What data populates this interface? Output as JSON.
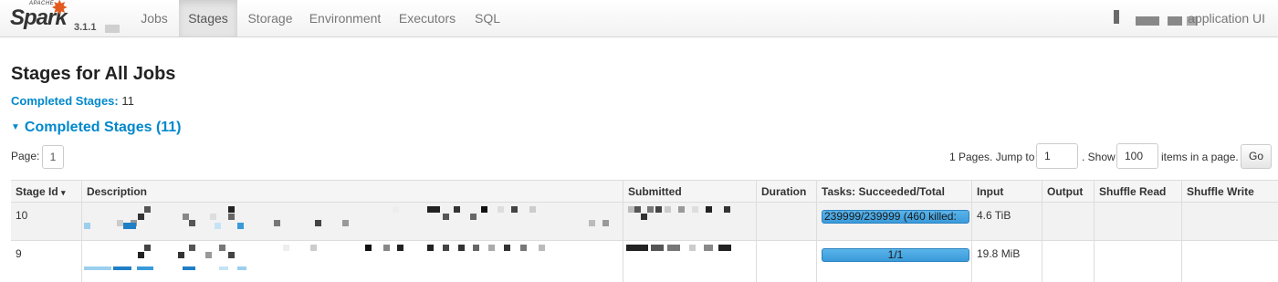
{
  "brand": {
    "apache": "APACHE",
    "name": "Spark",
    "version": "3.1.1"
  },
  "nav": {
    "tabs": [
      {
        "label": "Jobs"
      },
      {
        "label": "Stages"
      },
      {
        "label": "Storage"
      },
      {
        "label": "Environment"
      },
      {
        "label": "Executors"
      },
      {
        "label": "SQL"
      }
    ],
    "active_tab": "Stages",
    "app_label": "application UI"
  },
  "page": {
    "title": "Stages for All Jobs",
    "summary_label": "Completed Stages:",
    "summary_value": "11",
    "section_title": "Completed Stages (11)"
  },
  "pagination": {
    "page_label": "Page:",
    "current_page": "1",
    "pages_text": "1 Pages. Jump to",
    "jump_value": "1",
    "show_text": ". Show",
    "items_value": "100",
    "items_suffix": "items in a page.",
    "go_label": "Go"
  },
  "table": {
    "headers": [
      "Stage Id",
      "Description",
      "Submitted",
      "Duration",
      "Tasks: Succeeded/Total",
      "Input",
      "Output",
      "Shuffle Read",
      "Shuffle Write"
    ],
    "sort_indicator": "▾",
    "rows": [
      {
        "stage_id": "10",
        "tasks": "239999/239999 (460 killed:",
        "tasks_progress": 1.0,
        "input": "4.6 TiB",
        "output": "",
        "shuffle_read": "",
        "shuffle_write": ""
      },
      {
        "stage_id": "9",
        "tasks": "1/1",
        "tasks_progress": 1.0,
        "input": "19.8 MiB",
        "output": "",
        "shuffle_read": "",
        "shuffle_write": ""
      }
    ]
  },
  "colors": {
    "accent": "#0088cc",
    "brand_orange": "#e25a1c",
    "progress": "#3a9ad9"
  }
}
